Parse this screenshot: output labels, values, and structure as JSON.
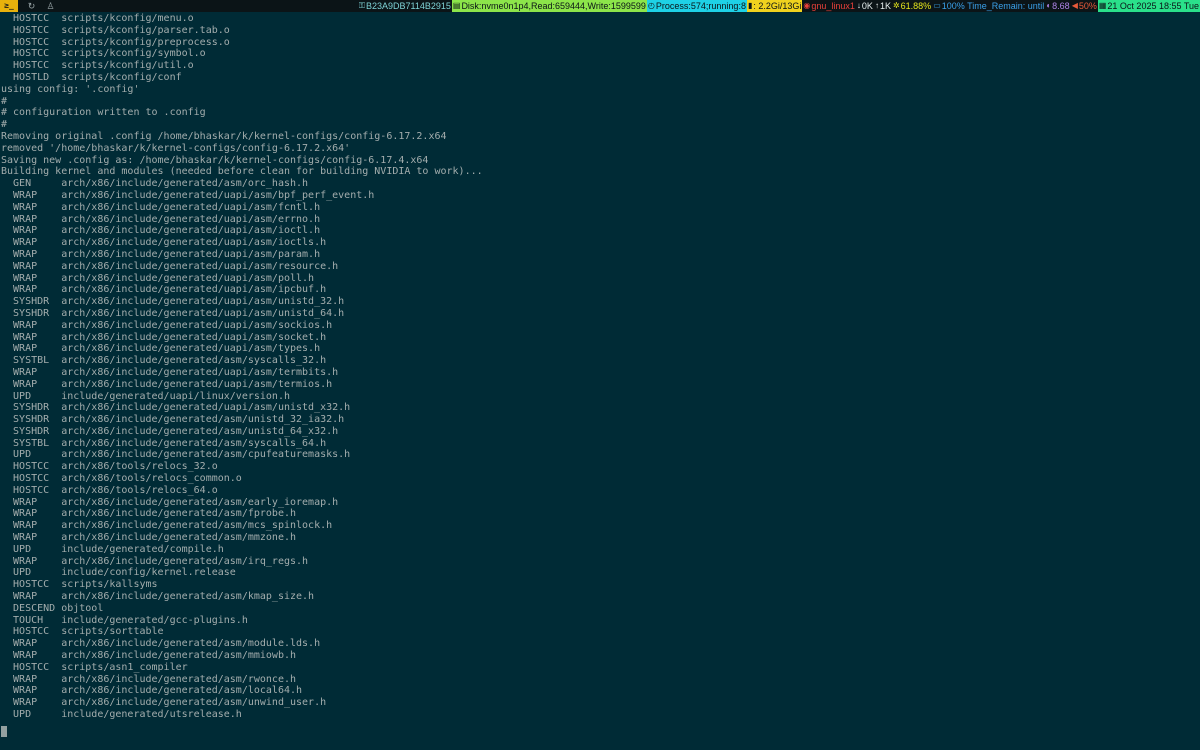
{
  "topbar": {
    "terminal_button": "≥_",
    "icons": [
      "refresh-icon",
      "tux-icon"
    ],
    "segments": [
      {
        "name": "hostid",
        "icon": "fingerprint-icon",
        "glyph": "⚿",
        "text": "B23A9DB7114B2915",
        "bg": "#0b1417",
        "fg": "#7fd3d6"
      },
      {
        "name": "disk",
        "icon": "disk-icon",
        "glyph": "▤",
        "text": "Disk:nvme0n1p4,Read:659444,Write:1599599",
        "bg": "#8ce54a",
        "fg": "#0b1417"
      },
      {
        "name": "process",
        "icon": "process-icon",
        "glyph": "◴",
        "text": "Process:574;running:8",
        "bg": "#1ed1e6",
        "fg": "#0b1417"
      },
      {
        "name": "memory",
        "icon": "memory-icon",
        "glyph": "▮",
        "text": ": 2.2Gi/13Gi",
        "bg": "#f0d21e",
        "fg": "#0b1417"
      },
      {
        "name": "network",
        "icon": "wifi-icon",
        "glyph": "◉",
        "text": "gnu_linux1",
        "bg": "#0b1417",
        "fg": "#e8403a"
      },
      {
        "name": "download",
        "icon": "arrow-down-icon",
        "glyph": "↓",
        "text": "0K",
        "bg": "#0b1417",
        "fg": "#e8f0f0"
      },
      {
        "name": "upload",
        "icon": "arrow-up-icon",
        "glyph": "↑",
        "text": "1K",
        "bg": "#0b1417",
        "fg": "#e8f0f0"
      },
      {
        "name": "cpu",
        "icon": "cpu-icon",
        "glyph": "✲",
        "text": "61.88%",
        "bg": "#0b1417",
        "fg": "#e6e61e"
      },
      {
        "name": "battery",
        "icon": "battery-icon",
        "glyph": "▭",
        "text": "100% Time_Remain: until",
        "bg": "#0b1417",
        "fg": "#3aa0e8"
      },
      {
        "name": "load",
        "icon": "gauge-icon",
        "glyph": "◐",
        "text": "8.68",
        "bg": "#0b1417",
        "fg": "#b084e8"
      },
      {
        "name": "volume",
        "icon": "volume-icon",
        "glyph": "◀",
        "text": "50%",
        "bg": "#0b1417",
        "fg": "#e85a3a"
      },
      {
        "name": "clock",
        "icon": "calendar-icon",
        "glyph": "▦",
        "text": "21 Oct 2025 18:55 Tue",
        "bg": "#2ae08a",
        "fg": "#0b1417"
      }
    ]
  },
  "terminal": {
    "lines": [
      "  HOSTCC  scripts/kconfig/menu.o",
      "  HOSTCC  scripts/kconfig/parser.tab.o",
      "  HOSTCC  scripts/kconfig/preprocess.o",
      "  HOSTCC  scripts/kconfig/symbol.o",
      "  HOSTCC  scripts/kconfig/util.o",
      "  HOSTLD  scripts/kconfig/conf",
      "using config: '.config'",
      "#",
      "# configuration written to .config",
      "#",
      "Removing original .config /home/bhaskar/k/kernel-configs/config-6.17.2.x64",
      "removed '/home/bhaskar/k/kernel-configs/config-6.17.2.x64'",
      "Saving new .config as: /home/bhaskar/k/kernel-configs/config-6.17.4.x64",
      "Building kernel and modules (needed before clean for building NVIDIA to work)...",
      "  GEN     arch/x86/include/generated/asm/orc_hash.h",
      "  WRAP    arch/x86/include/generated/uapi/asm/bpf_perf_event.h",
      "  WRAP    arch/x86/include/generated/uapi/asm/fcntl.h",
      "  WRAP    arch/x86/include/generated/uapi/asm/errno.h",
      "  WRAP    arch/x86/include/generated/uapi/asm/ioctl.h",
      "  WRAP    arch/x86/include/generated/uapi/asm/ioctls.h",
      "  WRAP    arch/x86/include/generated/uapi/asm/param.h",
      "  WRAP    arch/x86/include/generated/uapi/asm/resource.h",
      "  WRAP    arch/x86/include/generated/uapi/asm/poll.h",
      "  WRAP    arch/x86/include/generated/uapi/asm/ipcbuf.h",
      "  SYSHDR  arch/x86/include/generated/uapi/asm/unistd_32.h",
      "  SYSHDR  arch/x86/include/generated/uapi/asm/unistd_64.h",
      "  WRAP    arch/x86/include/generated/uapi/asm/sockios.h",
      "  WRAP    arch/x86/include/generated/uapi/asm/socket.h",
      "  WRAP    arch/x86/include/generated/uapi/asm/types.h",
      "  SYSTBL  arch/x86/include/generated/asm/syscalls_32.h",
      "  WRAP    arch/x86/include/generated/uapi/asm/termbits.h",
      "  WRAP    arch/x86/include/generated/uapi/asm/termios.h",
      "  UPD     include/generated/uapi/linux/version.h",
      "  SYSHDR  arch/x86/include/generated/uapi/asm/unistd_x32.h",
      "  SYSHDR  arch/x86/include/generated/asm/unistd_32_ia32.h",
      "  SYSHDR  arch/x86/include/generated/asm/unistd_64_x32.h",
      "  SYSTBL  arch/x86/include/generated/asm/syscalls_64.h",
      "  UPD     arch/x86/include/generated/asm/cpufeaturemasks.h",
      "  HOSTCC  arch/x86/tools/relocs_32.o",
      "  HOSTCC  arch/x86/tools/relocs_common.o",
      "  HOSTCC  arch/x86/tools/relocs_64.o",
      "  WRAP    arch/x86/include/generated/asm/early_ioremap.h",
      "  WRAP    arch/x86/include/generated/asm/fprobe.h",
      "  WRAP    arch/x86/include/generated/asm/mcs_spinlock.h",
      "  WRAP    arch/x86/include/generated/asm/mmzone.h",
      "  UPD     include/generated/compile.h",
      "  WRAP    arch/x86/include/generated/asm/irq_regs.h",
      "  UPD     include/config/kernel.release",
      "  HOSTCC  scripts/kallsyms",
      "  WRAP    arch/x86/include/generated/asm/kmap_size.h",
      "  DESCEND objtool",
      "  TOUCH   include/generated/gcc-plugins.h",
      "  HOSTCC  scripts/sorttable",
      "  WRAP    arch/x86/include/generated/asm/module.lds.h",
      "  WRAP    arch/x86/include/generated/asm/mmiowb.h",
      "  HOSTCC  scripts/asn1_compiler",
      "  WRAP    arch/x86/include/generated/asm/rwonce.h",
      "  WRAP    arch/x86/include/generated/asm/local64.h",
      "  WRAP    arch/x86/include/generated/asm/unwind_user.h",
      "  UPD     include/generated/utsrelease.h"
    ]
  }
}
